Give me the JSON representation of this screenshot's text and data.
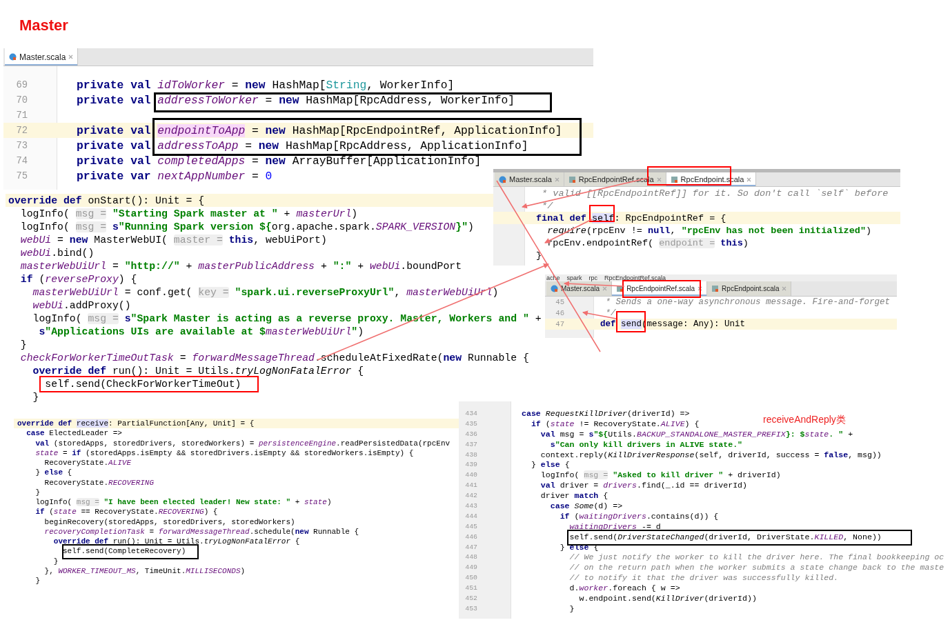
{
  "title": "Master",
  "note": "receiveAndReply类",
  "panels": [
    {
      "tabs": [
        {
          "label": "Master.scala",
          "selected": true
        }
      ],
      "boxes": [
        {
          "color": "#000000"
        },
        {
          "color": "#000000"
        }
      ],
      "lines": [
        {
          "number": "69",
          "current": false,
          "segs": [
            {
              "kw": "private val "
            },
            {
              "f": "idToWorker"
            },
            " = ",
            {
              "kw": "new "
            },
            "HashMap[",
            {
              "t": "String"
            },
            ", WorkerInfo]"
          ]
        },
        {
          "number": "70",
          "current": false,
          "segs": [
            {
              "kw": "private val "
            },
            {
              "f": "addressToWorker"
            },
            " = ",
            {
              "kw": "new "
            },
            "HashMap[RpcAddress, WorkerInfo]"
          ]
        },
        {
          "number": "71",
          "current": false
        },
        {
          "number": "72",
          "current": true,
          "segs": [
            {
              "kw": "private val "
            },
            {
              "pk": "endpointToApp"
            },
            " = ",
            {
              "kw": "new "
            },
            "HashMap[RpcEndpointRef, ApplicationInfo]"
          ]
        },
        {
          "number": "73",
          "current": false,
          "segs": [
            {
              "kw": "private val "
            },
            {
              "f": "addressToApp"
            },
            " = ",
            {
              "kw": "new "
            },
            "HashMap[RpcAddress, ApplicationInfo]"
          ]
        },
        {
          "number": "74",
          "current": false,
          "segs": [
            {
              "kw": "private val "
            },
            {
              "f": "completedApps"
            },
            " = ",
            {
              "kw": "new "
            },
            "ArrayBuffer[ApplicationInfo]"
          ]
        },
        {
          "number": "75",
          "current": false,
          "segs": [
            {
              "kw": "private var "
            },
            {
              "f": "nextAppNumber"
            },
            " = ",
            {
              "n": "0"
            }
          ]
        }
      ]
    },
    {
      "boxes": [
        {
          "color": "#ff0000"
        }
      ],
      "lines": [
        {
          "current": true,
          "segs": [
            {
              "kw": "override def "
            },
            "onStart(): Unit = {"
          ]
        },
        {
          "current": false,
          "segs": [
            "  logInfo( ",
            {
              "h": "msg ="
            },
            {
              "s": " \"Starting Spark master at \""
            },
            " + ",
            {
              "f": "masterUrl"
            },
            ")"
          ]
        },
        {
          "current": false,
          "segs": [
            "  logInfo( ",
            {
              "h": "msg ="
            },
            {
              "kw": " s"
            },
            {
              "s": "\"Running Spark version ${"
            },
            "org.apache.spark.",
            {
              "f": "SPARK_VERSION"
            },
            {
              "s": "}\""
            },
            ")"
          ]
        },
        {
          "current": false,
          "segs": [
            {
              "f": "  webUi"
            },
            " = ",
            {
              "kw": "new "
            },
            "MasterWebUI( ",
            {
              "h": "master ="
            },
            {
              "kw": " this"
            },
            ", webUiPort)"
          ]
        },
        {
          "current": false,
          "segs": [
            {
              "f": "  webUi"
            },
            ".bind()"
          ]
        },
        {
          "current": false,
          "segs": [
            {
              "f": "  masterWebUiUrl"
            },
            " = ",
            {
              "s": "\"http://\""
            },
            " + ",
            {
              "f": "masterPublicAddress"
            },
            " + ",
            {
              "s": "\":\""
            },
            " + ",
            {
              "f": "webUi"
            },
            ".boundPort"
          ]
        },
        {
          "current": false,
          "segs": [
            {
              "kw": "  if "
            },
            "(",
            {
              "f": "reverseProxy"
            },
            ") {"
          ]
        },
        {
          "current": false,
          "segs": [
            {
              "f": "    masterWebUiUrl"
            },
            " = conf.get( ",
            {
              "h": "key ="
            },
            {
              "s": " \"spark.ui.reverseProxyUrl\""
            },
            ", ",
            {
              "f": "masterWebUiUrl"
            },
            ")"
          ]
        },
        {
          "current": false,
          "segs": [
            {
              "f": "    webUi"
            },
            ".addProxy()"
          ]
        },
        {
          "current": false,
          "segs": [
            "    logInfo( ",
            {
              "h": "msg ="
            },
            {
              "kw": " s"
            },
            {
              "s": "\"Spark Master is acting as a reverse proxy. Master, Workers and \""
            },
            " +"
          ]
        },
        {
          "current": false,
          "segs": [
            {
              "kw": "     s"
            },
            {
              "s": "\"Applications UIs are available at $"
            },
            {
              "f": "masterWebUiUrl"
            },
            {
              "s": "\""
            },
            ")"
          ]
        },
        {
          "current": false,
          "segs": [
            "  }"
          ]
        },
        {
          "current": false,
          "segs": [
            {
              "f": "  checkForWorkerTimeOutTask"
            },
            " = ",
            {
              "f": "forwardMessageThread"
            },
            ".scheduleAtFixedRate(",
            {
              "kw": "new "
            },
            "Runnable {"
          ]
        },
        {
          "current": false,
          "segs": [
            {
              "kw": "    override def "
            },
            "run(): Unit = Utils.",
            {
              "i": "tryLogNonFatalError"
            },
            " {"
          ]
        },
        {
          "current": false,
          "segs": [
            "      self.send(CheckForWorkerTimeOut)"
          ]
        },
        {
          "current": false,
          "segs": [
            "    }"
          ]
        }
      ]
    },
    {
      "tabs": [
        {
          "label": "Master.scala",
          "selected": false
        },
        {
          "label": "RpcEndpointRef.scala",
          "selected": false
        },
        {
          "label": "RpcEndpoint.scala",
          "selected": true
        }
      ],
      "boxes": [
        {
          "color": "#ff0000"
        },
        {
          "color": "#ff0000"
        }
      ],
      "lines": [
        {
          "current": false,
          "segs": [
            {
              "c": " * valid [[RpcEndpointRef]] for it. So don't call `self` before"
            }
          ]
        },
        {
          "current": false,
          "segs": [
            {
              "c": " */"
            }
          ]
        },
        {
          "current": true,
          "segs": [
            {
              "kw": "final def "
            },
            {
              "sel": "self"
            },
            ": RpcEndpointRef = {"
          ]
        },
        {
          "current": false,
          "segs": [
            {
              "i": "  require"
            },
            "(rpcEnv != ",
            {
              "kw": "null"
            },
            ", ",
            {
              "s": "\"rpcEnv has not been initialized\""
            },
            ")"
          ]
        },
        {
          "current": false,
          "segs": [
            "  rpcEnv.endpointRef( ",
            {
              "h": "endpoint ="
            },
            {
              "kw": " this"
            },
            ")"
          ]
        },
        {
          "current": false,
          "segs": [
            "}"
          ]
        }
      ]
    },
    {
      "breadcrumb": [
        "ache",
        "spark",
        "rpc",
        "RpcEndpointRef.scala"
      ],
      "tabs": [
        {
          "label": "Master.scala",
          "selected": false
        },
        {
          "label": "RpcEndpointRef.scala",
          "selected": true
        },
        {
          "label": "RpcEndpoint.scala",
          "selected": false
        }
      ],
      "boxes": [
        {
          "color": "#ff0000"
        },
        {
          "color": "#ff0000"
        }
      ],
      "lines": [
        {
          "number": "45",
          "current": false,
          "segs": [
            {
              "c": " * Sends a one-way asynchronous message. Fire-and-forget"
            }
          ]
        },
        {
          "number": "46",
          "current": false,
          "segs": [
            {
              "c": " */"
            }
          ]
        },
        {
          "number": "47",
          "current": true,
          "segs": [
            {
              "kw": "def "
            },
            {
              "sel": "send"
            },
            "(message: Any): Unit"
          ]
        }
      ]
    },
    {
      "boxes": [
        {
          "color": "#000000"
        }
      ],
      "lines": [
        {
          "current": true,
          "segs": [
            {
              "kw": "override def "
            },
            {
              "sel": "receive"
            },
            ": PartialFunction[Any, Unit] = {"
          ]
        },
        {
          "current": false,
          "segs": [
            {
              "kw": "  case "
            },
            "ElectedLeader =>"
          ]
        },
        {
          "current": false,
          "segs": [
            {
              "kw": "    val "
            },
            "(storedApps, storedDrivers, storedWorkers) = ",
            {
              "f": "persistenceEngine"
            },
            ".readPersistedData(rpcEnv"
          ]
        },
        {
          "current": false,
          "segs": [
            {
              "f": "    state"
            },
            " = ",
            {
              "kw": "if "
            },
            "(storedApps.isEmpty && storedDrivers.isEmpty && storedWorkers.isEmpty) {"
          ]
        },
        {
          "current": false,
          "segs": [
            "      RecoveryState.",
            {
              "f": "ALIVE"
            }
          ]
        },
        {
          "current": false,
          "segs": [
            "    } ",
            {
              "kw": "else"
            },
            " {"
          ]
        },
        {
          "current": false,
          "segs": [
            "      RecoveryState.",
            {
              "f": "RECOVERING"
            }
          ]
        },
        {
          "current": false,
          "segs": [
            "    }"
          ]
        },
        {
          "current": false,
          "segs": [
            "    logInfo( ",
            {
              "h": "msg ="
            },
            {
              "s": " \"I have been elected leader! New state: \""
            },
            " + ",
            {
              "f": "state"
            },
            ")"
          ]
        },
        {
          "current": false,
          "segs": [
            {
              "kw": "    if"
            },
            " (",
            {
              "f": "state"
            },
            " == RecoveryState.",
            {
              "f": "RECOVERING"
            },
            ") {"
          ]
        },
        {
          "current": false,
          "segs": [
            "      beginRecovery(storedApps, storedDrivers, storedWorkers)"
          ]
        },
        {
          "current": false,
          "segs": [
            {
              "f": "      recoveryCompletionTask"
            },
            " = ",
            {
              "f": "forwardMessageThread"
            },
            ".schedule(",
            {
              "kw": "new"
            },
            " Runnable {"
          ]
        },
        {
          "current": false,
          "segs": [
            {
              "kw": "        override def "
            },
            "run(): Unit = Utils.",
            {
              "i": "tryLogNonFatalError"
            },
            " {"
          ]
        },
        {
          "current": false,
          "segs": [
            "          self.send(CompleteRecovery)"
          ]
        },
        {
          "current": false,
          "segs": [
            "        }"
          ]
        },
        {
          "current": false,
          "segs": [
            "      }, ",
            {
              "f": "WORKER_TIMEOUT_MS"
            },
            ", TimeUnit.",
            {
              "f": "MILLISECONDS"
            },
            ")"
          ]
        },
        {
          "current": false,
          "segs": [
            "    }"
          ]
        }
      ]
    },
    {
      "boxes": [
        {
          "color": "#000000"
        }
      ],
      "lines": [
        {
          "number": "434",
          "current": false,
          "segs": [
            {
              "kw": "case "
            },
            {
              "i": "RequestKillDriver"
            },
            "(driverId) =>"
          ]
        },
        {
          "number": "435",
          "current": false,
          "segs": [
            {
              "kw": "  if"
            },
            " (",
            {
              "f": "state"
            },
            " != RecoveryState.",
            {
              "f": "ALIVE"
            },
            ") {"
          ]
        },
        {
          "number": "436",
          "current": false,
          "segs": [
            {
              "kw": "    val"
            },
            " msg = ",
            {
              "kw": "s"
            },
            {
              "s": "\"${"
            },
            "Utils.",
            {
              "f": "BACKUP_STANDALONE_MASTER_PREFIX"
            },
            {
              "s": "}: $"
            },
            {
              "f": "state"
            },
            {
              "s": ". \""
            },
            " +"
          ]
        },
        {
          "number": "437",
          "current": false,
          "segs": [
            {
              "kw": "      s"
            },
            {
              "s": "\"Can only kill drivers in ALIVE state.\""
            }
          ]
        },
        {
          "number": "438",
          "current": false,
          "segs": [
            "    context.reply(",
            {
              "i": "KillDriverResponse"
            },
            "(self, driverId, success = ",
            {
              "kw": "false"
            },
            ", msg))"
          ]
        },
        {
          "number": "439",
          "current": false,
          "segs": [
            "  } ",
            {
              "kw": "else"
            },
            " {"
          ]
        },
        {
          "number": "440",
          "current": false,
          "segs": [
            "    logInfo( ",
            {
              "h": "msg ="
            },
            {
              "s": " \"Asked to kill driver \""
            },
            " + driverId)"
          ]
        },
        {
          "number": "441",
          "current": false,
          "segs": [
            {
              "kw": "    val"
            },
            " driver = ",
            {
              "f": "drivers"
            },
            ".find(_.id == driverId)"
          ]
        },
        {
          "number": "442",
          "current": false,
          "segs": [
            "    driver ",
            {
              "kw": "match"
            },
            " {"
          ]
        },
        {
          "number": "443",
          "current": false,
          "segs": [
            {
              "kw": "      case "
            },
            {
              "i": "Some"
            },
            "(d) =>"
          ]
        },
        {
          "number": "444",
          "current": false,
          "segs": [
            {
              "kw": "        if"
            },
            " (",
            {
              "f": "waitingDrivers"
            },
            ".contains(d)) {"
          ]
        },
        {
          "number": "445",
          "current": false,
          "segs": [
            {
              "f": "          waitingDrivers"
            },
            " -= d"
          ]
        },
        {
          "number": "446",
          "current": false,
          "segs": [
            "          self.send(",
            {
              "i": "DriverStateChanged"
            },
            "(driverId, DriverState.",
            {
              "f": "KILLED"
            },
            ", None))"
          ]
        },
        {
          "number": "447",
          "current": false,
          "segs": [
            "        } ",
            {
              "kw": "else"
            },
            " {"
          ]
        },
        {
          "number": "448",
          "current": false,
          "segs": [
            {
              "c": "          // We just notify the worker to kill the driver here. The final bookkeeping oc"
            }
          ]
        },
        {
          "number": "449",
          "current": false,
          "segs": [
            {
              "c": "          // on the return path when the worker submits a state change back to the maste"
            }
          ]
        },
        {
          "number": "450",
          "current": false,
          "segs": [
            {
              "c": "          // to notify it that the driver was successfully killed."
            }
          ]
        },
        {
          "number": "451",
          "current": false,
          "segs": [
            "          d.",
            {
              "f": "worker"
            },
            ".foreach { w =>"
          ]
        },
        {
          "number": "452",
          "current": false,
          "segs": [
            "            w.endpoint.send(",
            {
              "i": "KillDriver"
            },
            "(driverId))"
          ]
        },
        {
          "number": "453",
          "current": false,
          "segs": [
            "          }"
          ]
        }
      ]
    }
  ]
}
